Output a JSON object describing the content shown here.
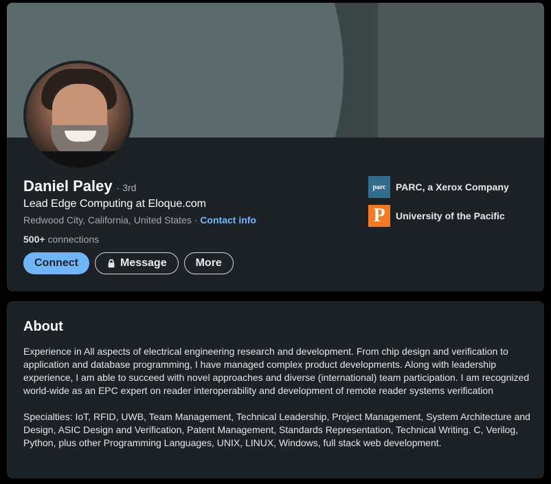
{
  "profile": {
    "name": "Daniel Paley",
    "degree": "· 3rd",
    "headline": "Lead Edge Computing at Eloque.com",
    "location": "Redwood City, California, United States · ",
    "contact_info": "Contact info",
    "connections_count": "500+",
    "connections_label": " connections",
    "actions": {
      "connect": "Connect",
      "message": "Message",
      "more": "More"
    },
    "organizations": [
      {
        "logo_text": "parc",
        "name": "PARC, a Xerox Company"
      },
      {
        "logo_text": "P",
        "name": "University of the Pacific"
      }
    ]
  },
  "about": {
    "title": "About",
    "text": "Experience in All aspects of electrical engineering research and development. From chip design and verification to application and database programming, I have managed complex product developments. Along with leadership experience, I am able to succeed with novel approaches and diverse (international) team participation. I am recognized world-wide as an EPC expert on reader interoperability and development of remote reader systems verification\n\nSpecialties: IoT, RFID, UWB, Team Management, Technical Leadership, Project Management, System Architecture and Design, ASIC Design and Verification, Patent Management, Standards Representation, Technical Writing. C, Verilog, Python, plus other Programming Languages, UNIX, LINUX, Windows, full stack web development."
  },
  "colors": {
    "page_bg": "#000000",
    "card_bg": "#1d2226",
    "accent_link": "#71b7fb",
    "primary_button": "#70b5f9"
  }
}
